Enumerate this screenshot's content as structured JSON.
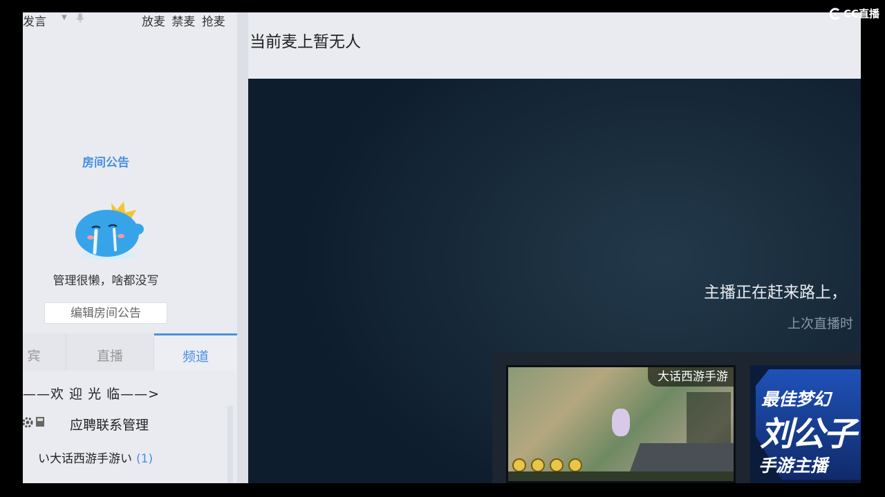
{
  "mic_bar": {
    "speak_label": "发言",
    "actions": [
      "放麦",
      "禁麦",
      "抢麦"
    ]
  },
  "notice": {
    "title": "房间公告",
    "empty_text": "管理很懒，啥都没写",
    "edit_button": "编辑房间公告"
  },
  "tabs": [
    {
      "label": "宾"
    },
    {
      "label": "直播"
    },
    {
      "label": "频道",
      "active": true
    }
  ],
  "channel": {
    "welcome": "——欢 迎 光 临——>",
    "manage_label": "应聘联系管理",
    "item_label": "い大话西游手游い",
    "item_count": "(1)"
  },
  "main": {
    "mic_status": "当前麦上暂无人",
    "offline_message": "主播正在赶来路上，",
    "last_live_label": "上次直播时"
  },
  "recommendations": [
    {
      "title": "大话西游手游"
    },
    {
      "line1": "最佳梦幻",
      "line2": "刘公子",
      "line3": "手游主播"
    }
  ],
  "brand": {
    "name": "CC直播"
  },
  "colors": {
    "accent": "#4a8fe0",
    "background": "#e9ebf1",
    "video_bg": "#1a2d3d"
  },
  "icons": [
    "caret-down-icon",
    "mic-icon",
    "gear-icon",
    "book-icon",
    "mascot-crying",
    "cc-logo-icon"
  ]
}
